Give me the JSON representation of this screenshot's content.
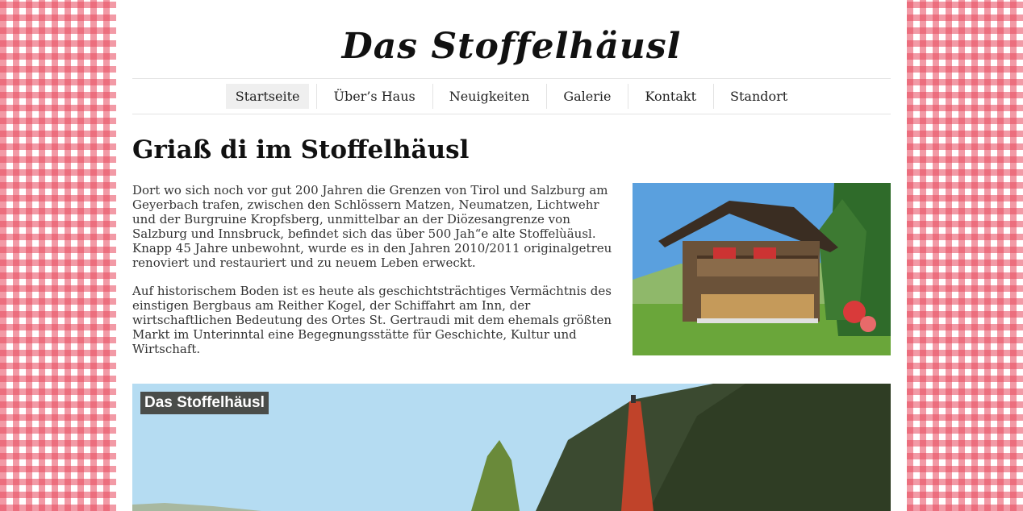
{
  "site": {
    "title": "Das Stoffelhäusl"
  },
  "nav": {
    "items": [
      {
        "label": "Startseite",
        "active": true
      },
      {
        "label": "Über’s Haus",
        "active": false
      },
      {
        "label": "Neuigkeiten",
        "active": false
      },
      {
        "label": "Galerie",
        "active": false
      },
      {
        "label": "Kontakt",
        "active": false
      },
      {
        "label": "Standort",
        "active": false
      }
    ]
  },
  "main": {
    "heading": "Griaß di im Stoffelhäusl",
    "paragraphs": [
      "Dort wo sich noch vor gut 200 Jahren die Grenzen von Tirol und Salzburg am Geyerbach trafen, zwischen den Schlössern Matzen, Neumatzen, Lichtwehr und der Burgruine Kropfsberg, unmittelbar an der Diözesangrenze von Salzburg und Innsbruck, befindet sich das über 500 Jah“e alte Stoffelùäusl. Knapp 45 Jahre unbewohnt, wurde es in den Jahren 2010/2011 originalgetreu renoviert und restauriert und zu neuem Leben erweckt.",
      "Auf historischem Boden ist es heute als geschichtsträchtiges Vermächtnis des einstigen Bergbaus am Reither Kogel, der Schiffahrt am Inn, der wirtschaftlichen Bedeutung des Ortes St. Gertraudi mit dem ehemals größten Markt im Unterinntal eine Begegnungsstätte für Geschichte, Kultur und Wirtschaft."
    ]
  },
  "banner": {
    "label": "Das Stoffelhäusl"
  },
  "colors": {
    "gingham": "#e8485c",
    "active_nav": "#efefef",
    "banner_label_bg": "#4a4d4a"
  }
}
